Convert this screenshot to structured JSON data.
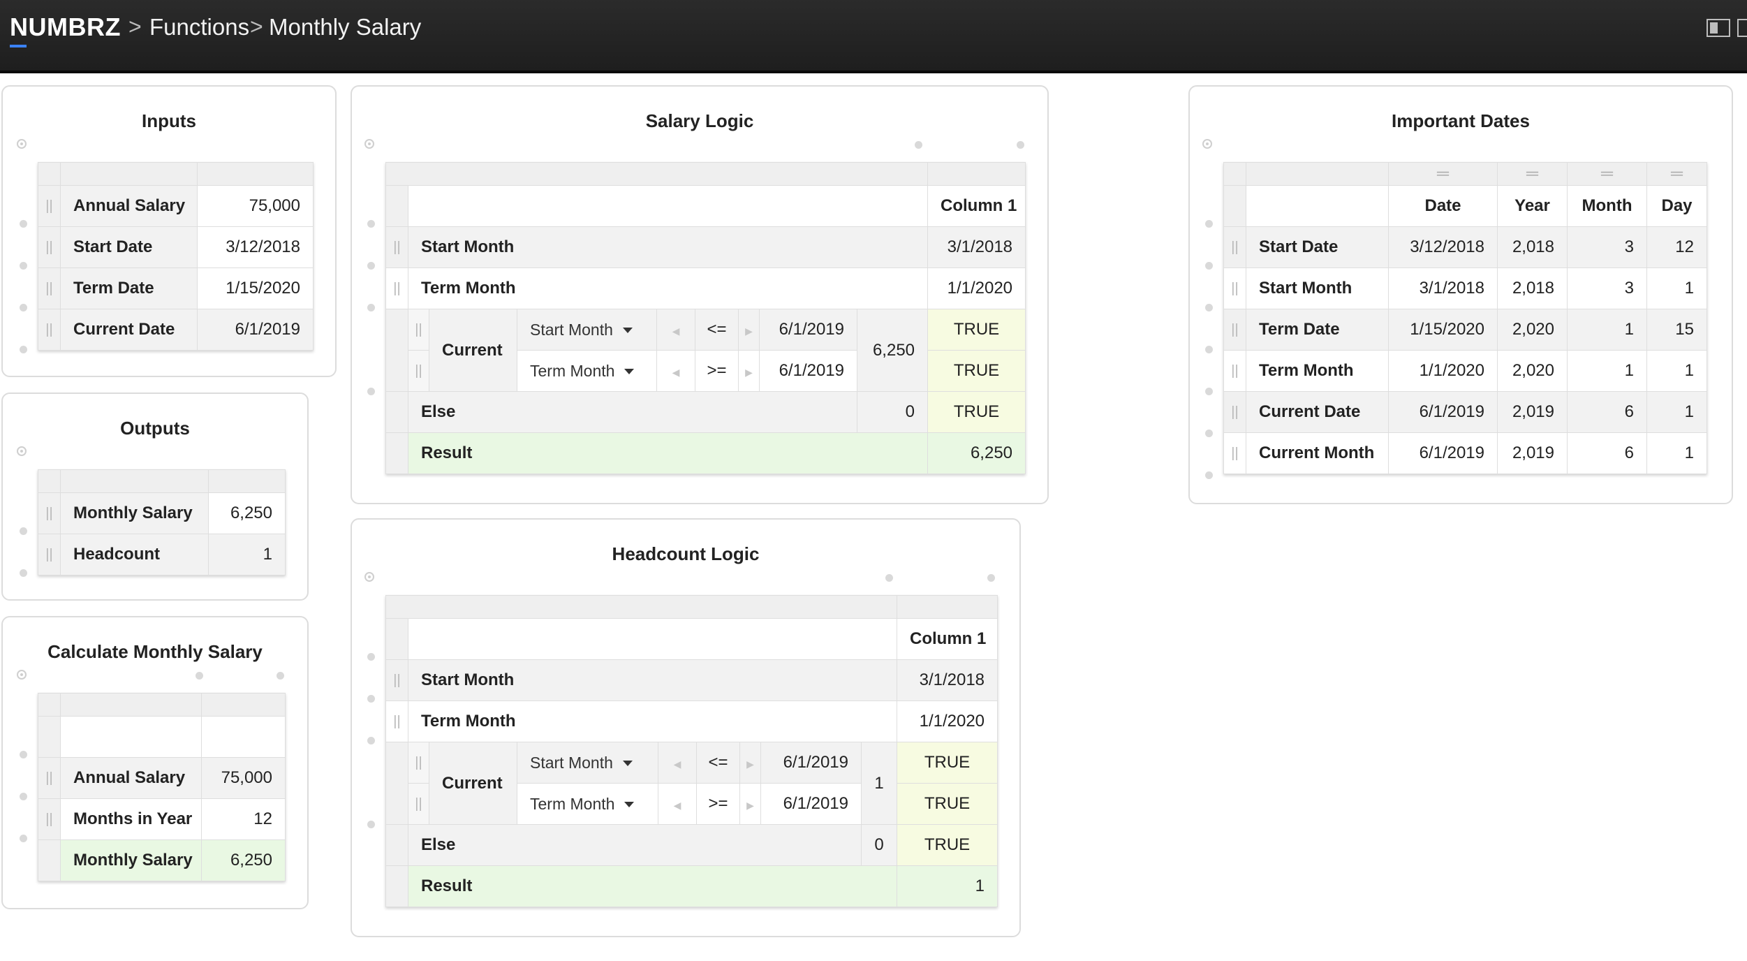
{
  "header": {
    "app_name": "NUMBRZ",
    "breadcrumb_sep": ">",
    "crumbs": [
      "Functions",
      "Monthly Salary"
    ]
  },
  "icons": {
    "handle": "drag-handle-icon",
    "toggle": "panel-toggle-icon",
    "dropdown": "chevron-down-icon"
  },
  "inputs": {
    "title": "Inputs",
    "rows": [
      {
        "label": "Annual Salary",
        "value": "75,000"
      },
      {
        "label": "Start Date",
        "value": "3/12/2018"
      },
      {
        "label": "Term Date",
        "value": "1/15/2020"
      },
      {
        "label": "Current Date",
        "value": "6/1/2019"
      }
    ]
  },
  "outputs": {
    "title": "Outputs",
    "rows": [
      {
        "label": "Monthly Salary",
        "value": "6,250"
      },
      {
        "label": "Headcount",
        "value": "1"
      }
    ]
  },
  "calc": {
    "title": "Calculate Monthly Salary",
    "rows": [
      {
        "label": "Annual Salary",
        "value": "75,000"
      },
      {
        "label": "Months in Year",
        "value": "12"
      },
      {
        "label": "Monthly Salary",
        "value": "6,250"
      }
    ]
  },
  "salary_logic": {
    "title": "Salary Logic",
    "column_header": "Column 1",
    "rows": [
      {
        "label": "Start Month",
        "value": "3/1/2018"
      },
      {
        "label": "Term Month",
        "value": "1/1/2020"
      }
    ],
    "current": {
      "label": "Current",
      "value": "6,250",
      "conditions": [
        {
          "field": "Start Month",
          "op": "<=",
          "operand": "6/1/2019",
          "result": "TRUE"
        },
        {
          "field": "Term Month",
          "op": ">=",
          "operand": "6/1/2019",
          "result": "TRUE"
        }
      ]
    },
    "else": {
      "label": "Else",
      "value": "0",
      "result": "TRUE"
    },
    "result": {
      "label": "Result",
      "value": "6,250"
    }
  },
  "headcount_logic": {
    "title": "Headcount Logic",
    "column_header": "Column 1",
    "rows": [
      {
        "label": "Start Month",
        "value": "3/1/2018"
      },
      {
        "label": "Term Month",
        "value": "1/1/2020"
      }
    ],
    "current": {
      "label": "Current",
      "value": "1",
      "conditions": [
        {
          "field": "Start Month",
          "op": "<=",
          "operand": "6/1/2019",
          "result": "TRUE"
        },
        {
          "field": "Term Month",
          "op": ">=",
          "operand": "6/1/2019",
          "result": "TRUE"
        }
      ]
    },
    "else": {
      "label": "Else",
      "value": "0",
      "result": "TRUE"
    },
    "result": {
      "label": "Result",
      "value": "1"
    }
  },
  "important_dates": {
    "title": "Important Dates",
    "columns": [
      "Date",
      "Year",
      "Month",
      "Day"
    ],
    "rows": [
      {
        "label": "Start Date",
        "cells": [
          "3/12/2018",
          "2,018",
          "3",
          "12"
        ]
      },
      {
        "label": "Start Month",
        "cells": [
          "3/1/2018",
          "2,018",
          "3",
          "1"
        ]
      },
      {
        "label": "Term Date",
        "cells": [
          "1/15/2020",
          "2,020",
          "1",
          "15"
        ]
      },
      {
        "label": "Term Month",
        "cells": [
          "1/1/2020",
          "2,020",
          "1",
          "1"
        ]
      },
      {
        "label": "Current Date",
        "cells": [
          "6/1/2019",
          "2,019",
          "6",
          "1"
        ]
      },
      {
        "label": "Current Month",
        "cells": [
          "6/1/2019",
          "2,019",
          "6",
          "1"
        ]
      }
    ]
  }
}
